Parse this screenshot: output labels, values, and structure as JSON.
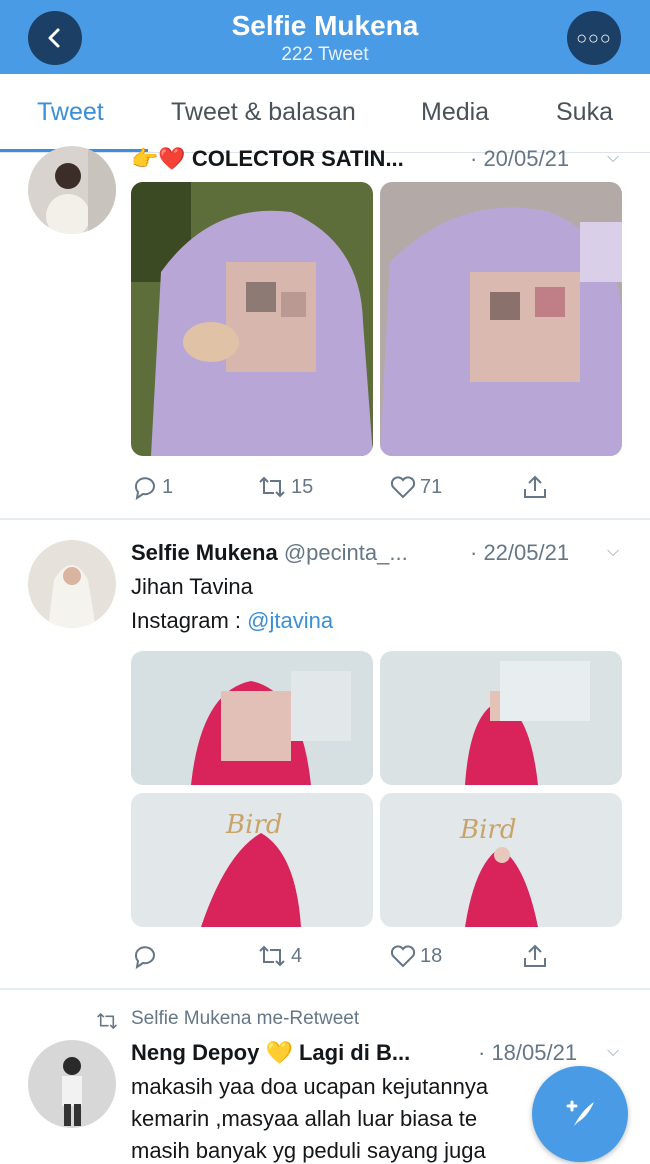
{
  "header": {
    "title": "Selfie Mukena",
    "subtitle": "222 Tweet"
  },
  "tabs": [
    {
      "label": "Tweet"
    },
    {
      "label": "Tweet & balasan"
    },
    {
      "label": "Media"
    },
    {
      "label": "Suka"
    }
  ],
  "tweets": [
    {
      "name": "COLECTOR SATIN...",
      "emoji": "👉❤️",
      "date": "· 20/05/21",
      "replies": "1",
      "retweets": "15",
      "likes": "71"
    },
    {
      "name": "Selfie Mukena",
      "handle": "@pecinta_...",
      "date": "· 22/05/21",
      "line1": "Jihan Tavina",
      "line2_prefix": "Instagram : ",
      "line2_link": "@jtavina",
      "replies": "",
      "retweets": "4",
      "likes": "18"
    },
    {
      "retweet_label": "Selfie Mukena me-Retweet",
      "name": "Neng Depoy 💛 Lagi di B...",
      "date": "· 18/05/21",
      "line1": "makasih yaa doa ucapan kejutannya",
      "line2": "kemarin ,masyaa allah luar biasa te",
      "line3": "masih banyak yg peduli sayang juga"
    }
  ],
  "colors": {
    "header": "#4a9be6",
    "accent": "#3a8fd8",
    "muted": "#657786",
    "mukena_lilac": "#b8a7d6",
    "mukena_red": "#d8245a"
  }
}
